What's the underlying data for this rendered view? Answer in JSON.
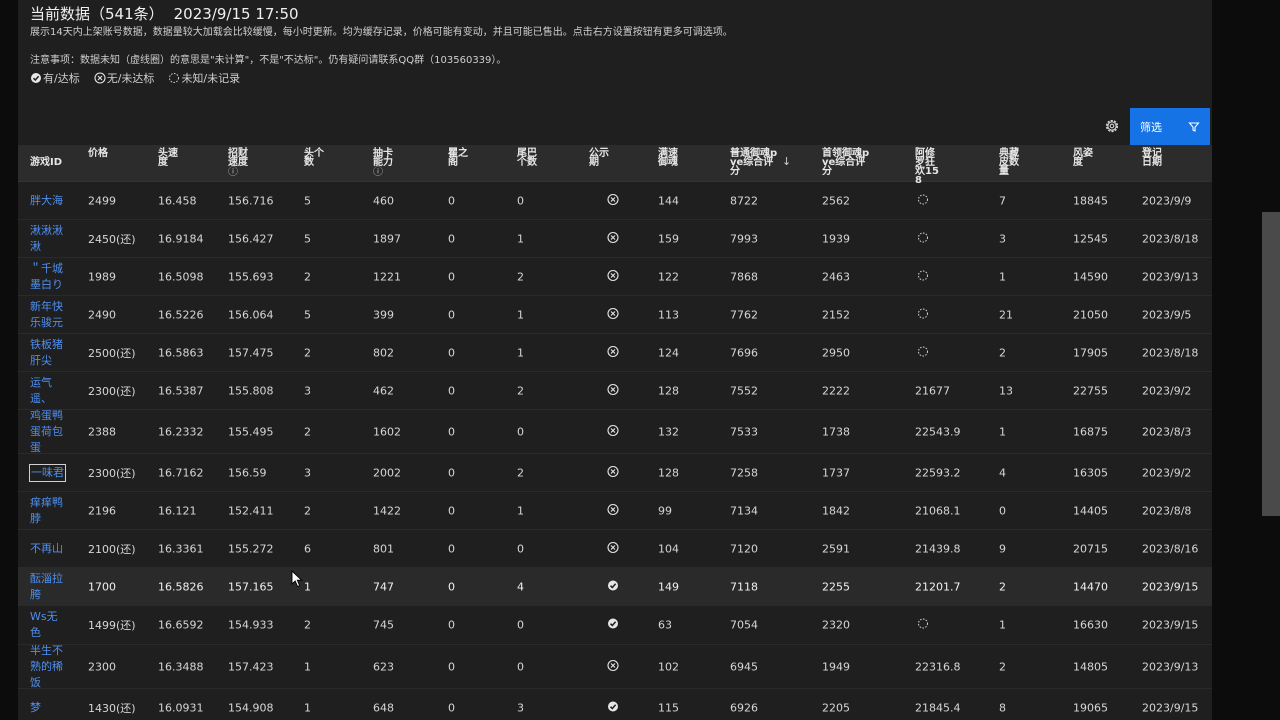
{
  "header": {
    "title": "当前数据（541条）",
    "timestamp": "2023/9/15 17:50",
    "description": "展示14天内上架账号数据，数据量较大加载会比较缓慢，每小时更新。均为缓存记录，价格可能有变动，并且可能已售出。点击右方设置按钮有更多可调选项。",
    "note": "注意事项：数据未知（虚线圈）的意思是\"未计算\"，不是\"不达标\"。仍有疑问请联系QQ群（103560339）。"
  },
  "legend": {
    "yes": "有/达标",
    "no": "无/未达标",
    "unknown": "未知/未记录"
  },
  "toolbar": {
    "filter_label": "筛选"
  },
  "columns": [
    {
      "key": "id",
      "label": "游戏ID"
    },
    {
      "key": "price",
      "label": "价格"
    },
    {
      "key": "speed",
      "label": "头速度"
    },
    {
      "key": "fortune",
      "label": "招财速度",
      "info": "ⓘ"
    },
    {
      "key": "heads",
      "label": "头个数"
    },
    {
      "key": "draw",
      "label": "抽卡能力",
      "info": "ⓘ"
    },
    {
      "key": "eye",
      "label": "瞿之阁"
    },
    {
      "key": "tail",
      "label": "尾巴个数"
    },
    {
      "key": "public",
      "label": "公示期"
    },
    {
      "key": "fullspeed",
      "label": "满速御魂"
    },
    {
      "key": "pve",
      "label": "普通御魂pve综合评分",
      "sorted": "↓"
    },
    {
      "key": "lead",
      "label": "首领御魂pve综合评分"
    },
    {
      "key": "asura",
      "label": "阿修罗狂欢158"
    },
    {
      "key": "skin",
      "label": "典藏皮数量"
    },
    {
      "key": "style",
      "label": "风姿度"
    },
    {
      "key": "date",
      "label": "登记日期"
    }
  ],
  "rows": [
    {
      "id": "胖大海",
      "price": "2499",
      "speed": "16.458",
      "fortune": "156.716",
      "heads": "5",
      "draw": "460",
      "eye": "0",
      "tail": "0",
      "public": "no",
      "fullspeed": "144",
      "pve": "8722",
      "lead": "2562",
      "asura": "",
      "skin": "7",
      "style": "18845",
      "date": "2023/9/9"
    },
    {
      "id": "湫湫湫湫",
      "price": "2450(还)",
      "speed": "16.9184",
      "fortune": "156.427",
      "heads": "5",
      "draw": "1897",
      "eye": "0",
      "tail": "1",
      "public": "no",
      "fullspeed": "159",
      "pve": "7993",
      "lead": "1939",
      "asura": "",
      "skin": "3",
      "style": "12545",
      "date": "2023/8/18"
    },
    {
      "id": "＂千城墨白り",
      "price": "1989",
      "speed": "16.5098",
      "fortune": "155.693",
      "heads": "2",
      "draw": "1221",
      "eye": "0",
      "tail": "2",
      "public": "no",
      "fullspeed": "122",
      "pve": "7868",
      "lead": "2463",
      "asura": "",
      "skin": "1",
      "style": "14590",
      "date": "2023/9/13"
    },
    {
      "id": "新年快乐骏元",
      "price": "2490",
      "speed": "16.5226",
      "fortune": "156.064",
      "heads": "5",
      "draw": "399",
      "eye": "0",
      "tail": "1",
      "public": "no",
      "fullspeed": "113",
      "pve": "7762",
      "lead": "2152",
      "asura": "",
      "skin": "21",
      "style": "21050",
      "date": "2023/9/5"
    },
    {
      "id": "铁板猪肝尖",
      "price": "2500(还)",
      "speed": "16.5863",
      "fortune": "157.475",
      "heads": "2",
      "draw": "802",
      "eye": "0",
      "tail": "1",
      "public": "no",
      "fullspeed": "124",
      "pve": "7696",
      "lead": "2950",
      "asura": "",
      "skin": "2",
      "style": "17905",
      "date": "2023/8/18"
    },
    {
      "id": "运气遥、",
      "price": "2300(还)",
      "speed": "16.5387",
      "fortune": "155.808",
      "heads": "3",
      "draw": "462",
      "eye": "0",
      "tail": "2",
      "public": "no",
      "fullspeed": "128",
      "pve": "7552",
      "lead": "2222",
      "asura": "21677",
      "skin": "13",
      "style": "22755",
      "date": "2023/9/2"
    },
    {
      "id": "鸡蛋鸭蛋荷包蛋",
      "price": "2388",
      "speed": "16.2332",
      "fortune": "155.495",
      "heads": "2",
      "draw": "1602",
      "eye": "0",
      "tail": "0",
      "public": "no",
      "fullspeed": "132",
      "pve": "7533",
      "lead": "1738",
      "asura": "22543.9",
      "skin": "1",
      "style": "16875",
      "date": "2023/8/3"
    },
    {
      "id": "一味君",
      "price": "2300(还)",
      "speed": "16.7162",
      "fortune": "156.59",
      "heads": "3",
      "draw": "2002",
      "eye": "0",
      "tail": "2",
      "public": "no",
      "fullspeed": "128",
      "pve": "7258",
      "lead": "1737",
      "asura": "22593.2",
      "skin": "4",
      "style": "16305",
      "date": "2023/9/2"
    },
    {
      "id": "痒痒鸭脖",
      "price": "2196",
      "speed": "16.121",
      "fortune": "152.411",
      "heads": "2",
      "draw": "1422",
      "eye": "0",
      "tail": "1",
      "public": "no",
      "fullspeed": "99",
      "pve": "7134",
      "lead": "1842",
      "asura": "21068.1",
      "skin": "0",
      "style": "14405",
      "date": "2023/8/8"
    },
    {
      "id": "不再山",
      "price": "2100(还)",
      "speed": "16.3361",
      "fortune": "155.272",
      "heads": "6",
      "draw": "801",
      "eye": "0",
      "tail": "0",
      "public": "no",
      "fullspeed": "104",
      "pve": "7120",
      "lead": "2591",
      "asura": "21439.8",
      "skin": "9",
      "style": "20715",
      "date": "2023/8/16"
    },
    {
      "id": "酝淄拉胯",
      "price": "1700",
      "speed": "16.5826",
      "fortune": "157.165",
      "heads": "1",
      "draw": "747",
      "eye": "0",
      "tail": "4",
      "public": "yes",
      "fullspeed": "149",
      "pve": "7118",
      "lead": "2255",
      "asura": "21201.7",
      "skin": "2",
      "style": "14470",
      "date": "2023/9/15"
    },
    {
      "id": "Ws无色",
      "price": "1499(还)",
      "speed": "16.6592",
      "fortune": "154.933",
      "heads": "2",
      "draw": "745",
      "eye": "0",
      "tail": "0",
      "public": "yes",
      "fullspeed": "63",
      "pve": "7054",
      "lead": "2320",
      "asura": "",
      "skin": "1",
      "style": "16630",
      "date": "2023/9/15"
    },
    {
      "id": "半生不熟的稀饭",
      "price": "2300",
      "speed": "16.3488",
      "fortune": "157.423",
      "heads": "1",
      "draw": "623",
      "eye": "0",
      "tail": "0",
      "public": "no",
      "fullspeed": "102",
      "pve": "6945",
      "lead": "1949",
      "asura": "22316.8",
      "skin": "2",
      "style": "14805",
      "date": "2023/9/13"
    },
    {
      "id": "梦",
      "price": "1430(还)",
      "speed": "16.0931",
      "fortune": "154.908",
      "heads": "1",
      "draw": "648",
      "eye": "0",
      "tail": "3",
      "public": "yes",
      "fullspeed": "115",
      "pve": "6926",
      "lead": "2205",
      "asura": "21845.4",
      "skin": "8",
      "style": "19065",
      "date": "2023/9/15"
    }
  ]
}
